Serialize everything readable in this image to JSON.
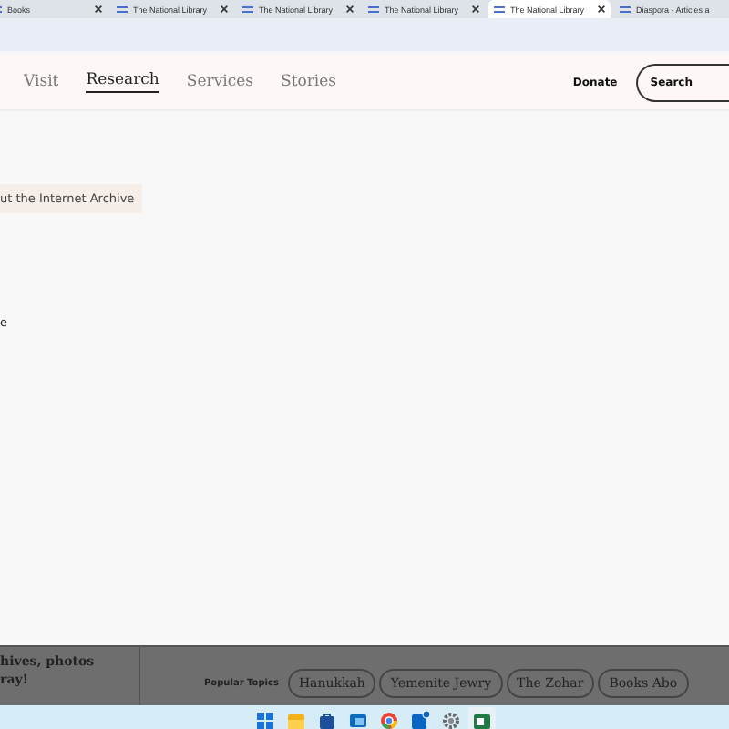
{
  "browser_tabs": [
    {
      "title": "Books",
      "selected": false
    },
    {
      "title": "The National Library",
      "selected": false
    },
    {
      "title": "The National Library",
      "selected": false
    },
    {
      "title": "The National Library",
      "selected": false
    },
    {
      "title": "The National Library",
      "selected": true
    },
    {
      "title": "Diaspora - Articles a",
      "selected": false
    }
  ],
  "nav": {
    "links": [
      {
        "label": "Visit",
        "selected": false
      },
      {
        "label": "Research",
        "selected": true
      },
      {
        "label": "Services",
        "selected": false
      },
      {
        "label": "Stories",
        "selected": false
      }
    ],
    "donate": "Donate",
    "search": "Search"
  },
  "panel": {
    "tag": "ut the Internet Archive",
    "fragment": "e"
  },
  "footer": {
    "promo_lines": [
      "hives, photos",
      "ray!"
    ],
    "topics_label": "Popular Topics",
    "topics": [
      "Hanukkah",
      "Yemenite Jewry",
      "The Zohar",
      "Books Abo"
    ]
  },
  "taskbar": {
    "apps": [
      {
        "kind": "start",
        "active": false
      },
      {
        "kind": "folder",
        "active": false
      },
      {
        "kind": "store",
        "active": false
      },
      {
        "kind": "mail",
        "active": false
      },
      {
        "kind": "browser",
        "active": false
      },
      {
        "kind": "network",
        "active": false
      },
      {
        "kind": "settings",
        "active": false
      },
      {
        "kind": "sheet",
        "active": true
      }
    ]
  }
}
